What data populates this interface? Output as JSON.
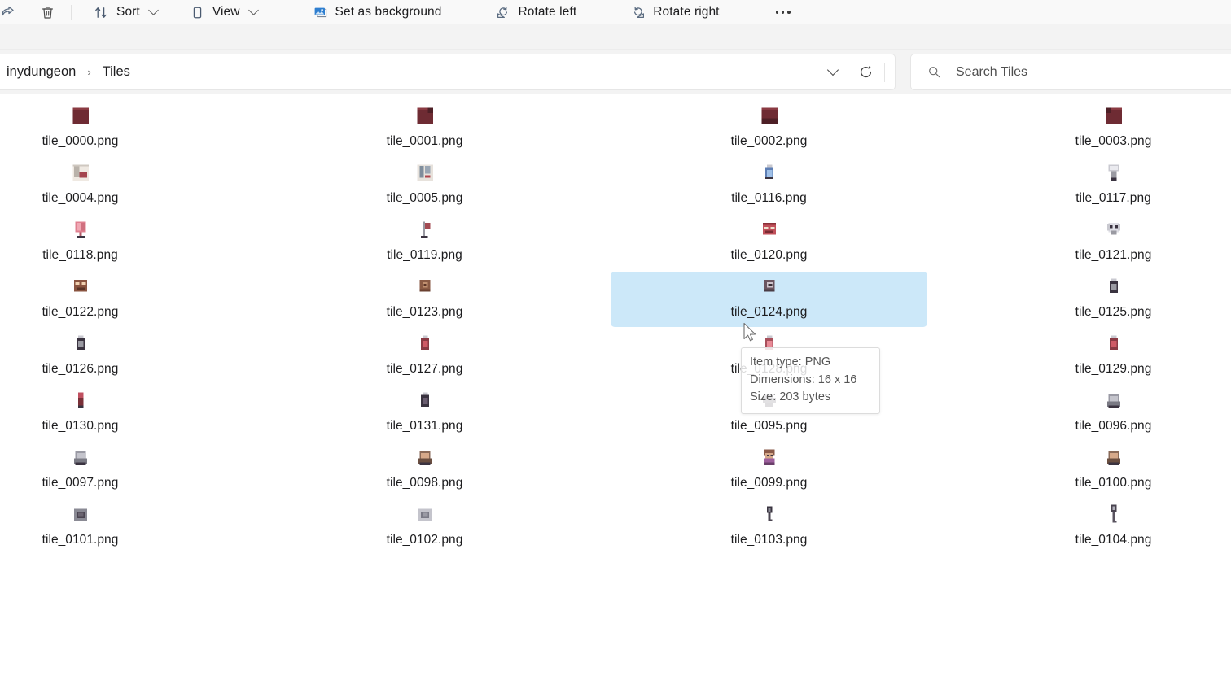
{
  "toolbar": {
    "items": [
      {
        "icon": "share-icon",
        "label": "",
        "chevron": false
      },
      {
        "icon": "delete-icon",
        "label": "",
        "chevron": false
      },
      {
        "icon": "sort-icon",
        "label": "Sort",
        "chevron": true
      },
      {
        "icon": "view-icon",
        "label": "View",
        "chevron": true
      },
      {
        "icon": "set-background-icon",
        "label": "Set as background",
        "chevron": false
      },
      {
        "icon": "rotate-left-icon",
        "label": "Rotate left",
        "chevron": false
      },
      {
        "icon": "rotate-right-icon",
        "label": "Rotate right",
        "chevron": false
      }
    ],
    "overflow_label": "See more"
  },
  "address_bar": {
    "breadcrumb": [
      {
        "label": "inydungeon"
      },
      {
        "label": "Tiles"
      }
    ],
    "separator": "›",
    "dropdown_icon": "chevron-down-icon",
    "refresh_icon": "refresh-icon",
    "refresh_label": "Refresh"
  },
  "search": {
    "icon": "search-icon",
    "placeholder": "Search Tiles",
    "value": ""
  },
  "files": [
    {
      "name": "tile_0000.png",
      "tile": "block-plain",
      "col": 0,
      "row": 0,
      "selected": false
    },
    {
      "name": "tile_0001.png",
      "tile": "block-corner",
      "col": 1,
      "row": 0,
      "selected": false
    },
    {
      "name": "tile_0002.png",
      "tile": "block-edge",
      "col": 2,
      "row": 0,
      "selected": false
    },
    {
      "name": "tile_0003.png",
      "tile": "block-notch",
      "col": 3,
      "row": 0,
      "selected": false
    },
    {
      "name": "tile_0004.png",
      "tile": "wall-banner",
      "col": 0,
      "row": 1,
      "selected": false
    },
    {
      "name": "tile_0005.png",
      "tile": "wall-window",
      "col": 1,
      "row": 1,
      "selected": false
    },
    {
      "name": "tile_0116.png",
      "tile": "potion-blue",
      "col": 2,
      "row": 1,
      "selected": false
    },
    {
      "name": "tile_0117.png",
      "tile": "mushroom-grey",
      "col": 3,
      "row": 1,
      "selected": false
    },
    {
      "name": "tile_0118.png",
      "tile": "brain",
      "col": 0,
      "row": 2,
      "selected": false
    },
    {
      "name": "tile_0119.png",
      "tile": "flag-small",
      "col": 1,
      "row": 2,
      "selected": false
    },
    {
      "name": "tile_0120.png",
      "tile": "face-red",
      "col": 2,
      "row": 2,
      "selected": false
    },
    {
      "name": "tile_0121.png",
      "tile": "skull-grey",
      "col": 3,
      "row": 2,
      "selected": false
    },
    {
      "name": "tile_0122.png",
      "tile": "face-brown",
      "col": 0,
      "row": 3,
      "selected": false
    },
    {
      "name": "tile_0123.png",
      "tile": "swirl-brown",
      "col": 1,
      "row": 3,
      "selected": false
    },
    {
      "name": "tile_0124.png",
      "tile": "swirl-dark",
      "col": 2,
      "row": 3,
      "selected": true
    },
    {
      "name": "tile_0125.png",
      "tile": "vial-grey",
      "col": 3,
      "row": 3,
      "selected": false
    },
    {
      "name": "tile_0126.png",
      "tile": "vial-grey",
      "col": 0,
      "row": 4,
      "selected": false
    },
    {
      "name": "tile_0127.png",
      "tile": "vial-red",
      "col": 1,
      "row": 4,
      "selected": false
    },
    {
      "name": "tile_0128.png",
      "tile": "vial-pink",
      "col": 2,
      "row": 4,
      "selected": false
    },
    {
      "name": "tile_0129.png",
      "tile": "vial-red",
      "col": 3,
      "row": 4,
      "selected": false
    },
    {
      "name": "tile_0130.png",
      "tile": "torch-red",
      "col": 0,
      "row": 5,
      "selected": false
    },
    {
      "name": "tile_0131.png",
      "tile": "vial-dark",
      "col": 1,
      "row": 5,
      "selected": false
    },
    {
      "name": "tile_0095.png",
      "tile": "anvil-dark",
      "col": 2,
      "row": 5,
      "selected": false
    },
    {
      "name": "tile_0096.png",
      "tile": "hood-grey",
      "col": 3,
      "row": 5,
      "selected": false
    },
    {
      "name": "tile_0097.png",
      "tile": "hood-grey",
      "col": 0,
      "row": 6,
      "selected": false
    },
    {
      "name": "tile_0098.png",
      "tile": "hood-tan",
      "col": 1,
      "row": 6,
      "selected": false
    },
    {
      "name": "tile_0099.png",
      "tile": "girl-purple",
      "col": 2,
      "row": 6,
      "selected": false
    },
    {
      "name": "tile_0100.png",
      "tile": "hood-tan",
      "col": 3,
      "row": 6,
      "selected": false
    },
    {
      "name": "tile_0101.png",
      "tile": "chest-dark",
      "col": 0,
      "row": 7,
      "selected": false
    },
    {
      "name": "tile_0102.png",
      "tile": "chest-grey",
      "col": 1,
      "row": 7,
      "selected": false
    },
    {
      "name": "tile_0103.png",
      "tile": "key-dark",
      "col": 2,
      "row": 7,
      "selected": false
    },
    {
      "name": "tile_0104.png",
      "tile": "key-long",
      "col": 3,
      "row": 7,
      "selected": false
    }
  ],
  "tooltip": {
    "item_type": "Item type: PNG",
    "dimensions": "Dimensions: 16 x 16",
    "size": "Size: 203 bytes"
  },
  "colors": {
    "selection": "#cce8f9",
    "toolbar_bg": "#f9f9f9",
    "chrome_bg": "#f3f3f3",
    "content_bg": "#ffffff",
    "text": "#1d1d1f",
    "accent": "#0f6cbd"
  }
}
